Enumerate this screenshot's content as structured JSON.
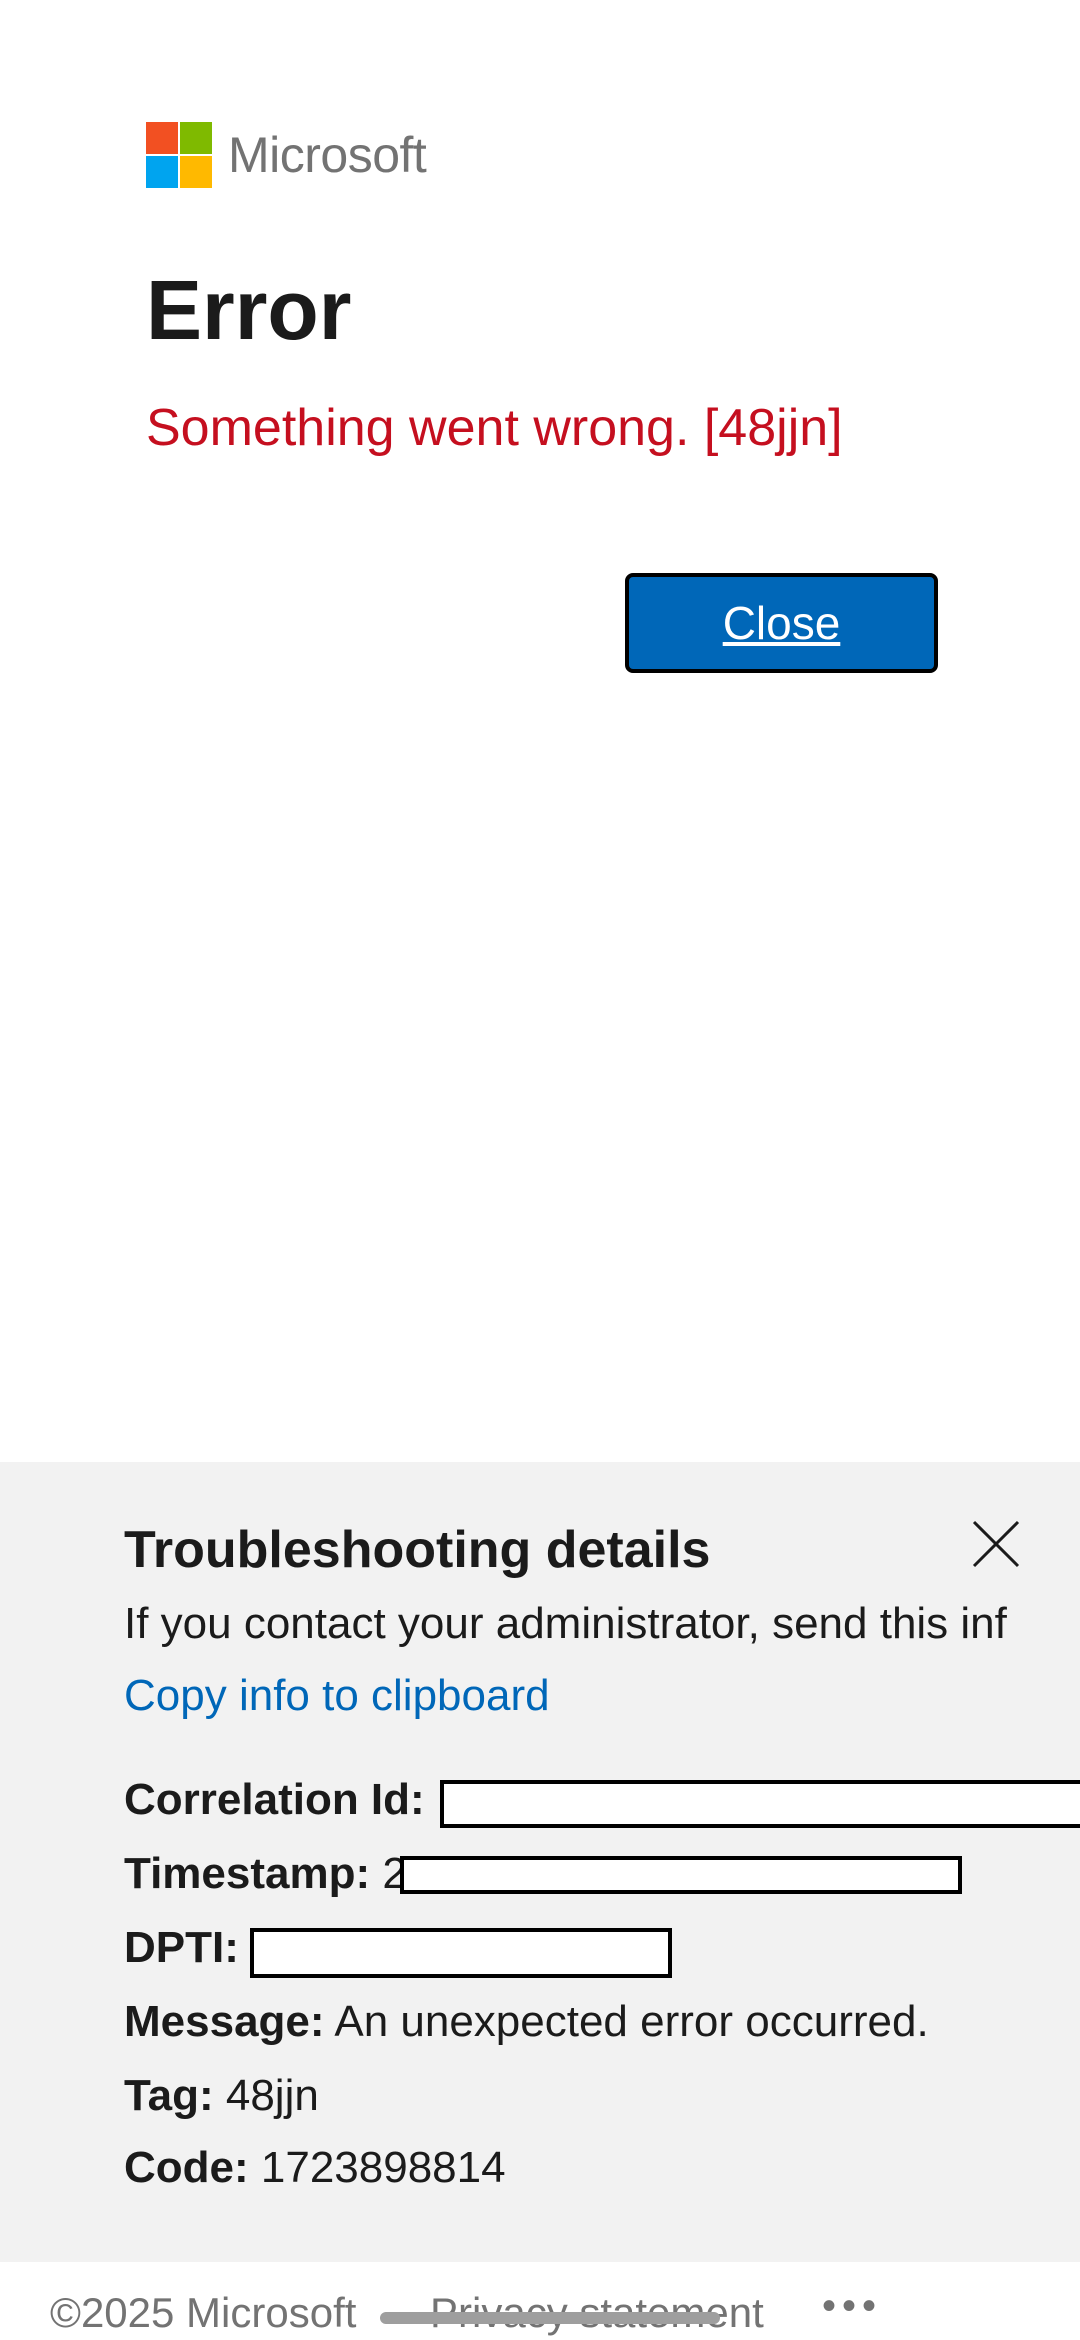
{
  "brand": {
    "name": "Microsoft",
    "logo_colors": [
      "#f25022",
      "#7fba00",
      "#00a4ef",
      "#ffb900"
    ]
  },
  "error": {
    "title": "Error",
    "message": "Something went wrong. [48jjn]",
    "message_color": "#c50f1f"
  },
  "close_button": {
    "label": "Close",
    "bg_color": "#0067b8"
  },
  "troubleshooting": {
    "title": "Troubleshooting details",
    "description": "If you contact your administrator, send this inf",
    "copy_link": "Copy info to clipboard",
    "link_color": "#0067b8",
    "fields": {
      "correlation_id_label": "Correlation Id:",
      "timestamp_label": "Timestamp:",
      "timestamp_visible_char": "2",
      "dpti_label": "DPTI:",
      "message_label": "Message:",
      "message_value": "An unexpected error occurred.",
      "tag_label": "Tag:",
      "tag_value": "48jjn",
      "code_label": "Code:",
      "code_value": "1723898814"
    },
    "close_icon": "close-x-icon"
  },
  "footer": {
    "copyright": "©2025 Microsoft",
    "privacy": "Privacy statement",
    "more": "•••"
  }
}
